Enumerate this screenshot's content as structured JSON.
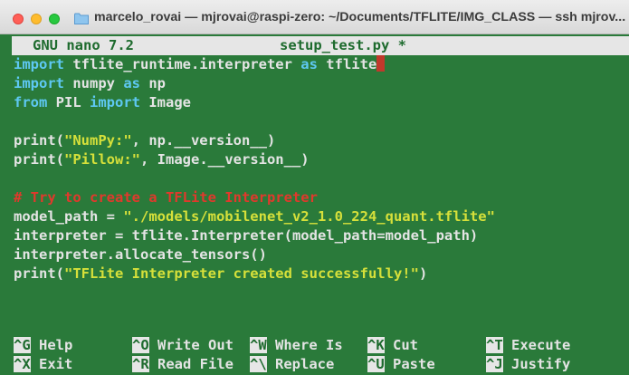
{
  "window": {
    "title": "marcelo_rovai — mjrovai@raspi-zero: ~/Documents/TFLITE/IMG_CLASS — ssh mjrov..."
  },
  "nano": {
    "version": "GNU nano 7.2",
    "filename": "setup_test.py *"
  },
  "code": {
    "line1": {
      "kw1": "import",
      "mod": " tflite_runtime.interpreter ",
      "kw2": "as",
      "alias": " tflite"
    },
    "line2": {
      "kw1": "import",
      "mod": " numpy ",
      "kw2": "as",
      "alias": " np"
    },
    "line3": {
      "kw1": "from",
      "mod": " PIL ",
      "kw2": "import",
      "alias": " Image"
    },
    "line5": {
      "a": "print(",
      "s": "\"NumPy:\"",
      "b": ", np.__version__)"
    },
    "line6": {
      "a": "print(",
      "s": "\"Pillow:\"",
      "b": ", Image.__version__)"
    },
    "line8": "# Try to create a TFLite Interpreter",
    "line9": {
      "a": "model_path = ",
      "s": "\"./models/mobilenet_v2_1.0_224_quant.tflite\""
    },
    "line10": "interpreter = tflite.Interpreter(model_path=model_path)",
    "line11": "interpreter.allocate_tensors()",
    "line12": {
      "a": "print(",
      "s": "\"TFLite Interpreter created successfully!\"",
      "b": ")"
    }
  },
  "shortcuts": {
    "row1": [
      {
        "key": "^G",
        "label": " Help"
      },
      {
        "key": "^O",
        "label": " Write Out"
      },
      {
        "key": "^W",
        "label": " Where Is"
      },
      {
        "key": "^K",
        "label": " Cut"
      },
      {
        "key": "^T",
        "label": " Execute"
      }
    ],
    "row2": [
      {
        "key": "^X",
        "label": " Exit"
      },
      {
        "key": "^R",
        "label": " Read File"
      },
      {
        "key": "^\\",
        "label": " Replace"
      },
      {
        "key": "^U",
        "label": " Paste"
      },
      {
        "key": "^J",
        "label": " Justify"
      }
    ]
  },
  "colors": {
    "terminal_bg": "#2a7a3a",
    "keyword": "#5ec8f2",
    "string": "#d6e03a",
    "comment": "#e0392c",
    "cursor": "#c0392b"
  }
}
